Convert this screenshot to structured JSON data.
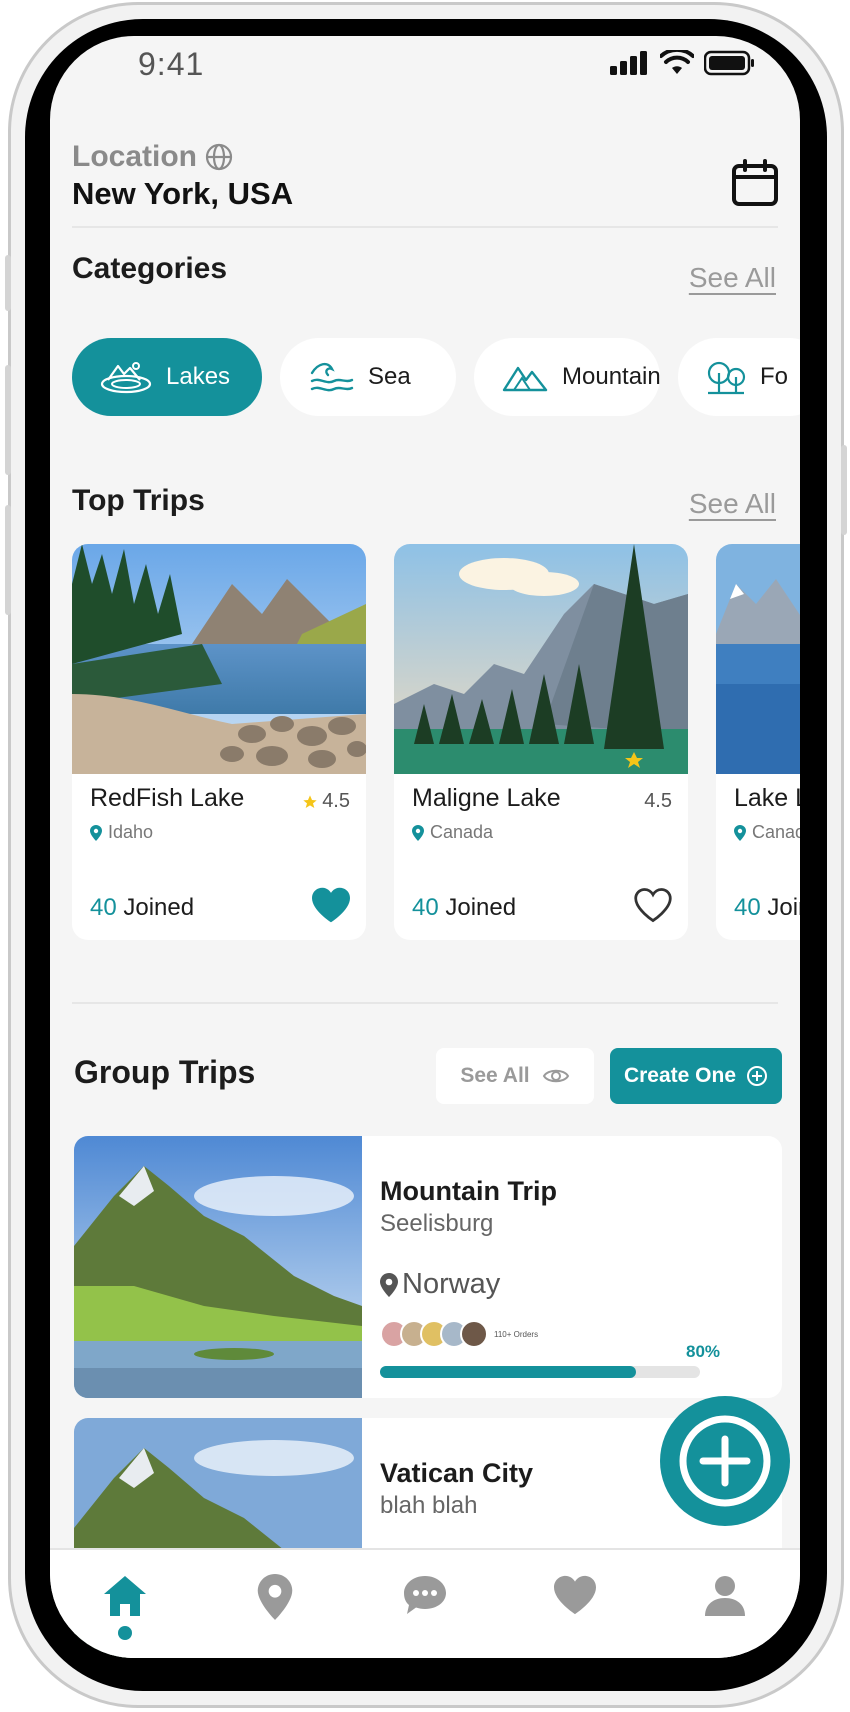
{
  "status_bar": {
    "time": "9:41"
  },
  "header": {
    "location_label": "Location",
    "location_value": "New York, USA"
  },
  "categories": {
    "title": "Categories",
    "see_all": "See All",
    "items": [
      {
        "label": "Lakes",
        "icon": "lake-icon",
        "active": true
      },
      {
        "label": "Sea",
        "icon": "wave-icon",
        "active": false
      },
      {
        "label": "Mountain",
        "icon": "mountain-icon",
        "active": false
      },
      {
        "label": "Fo",
        "icon": "forest-icon",
        "active": false
      }
    ]
  },
  "top_trips": {
    "title": "Top Trips",
    "see_all": "See All",
    "cards": [
      {
        "name": "RedFish Lake",
        "rating": "4.5",
        "place": "Idaho",
        "joined_count": "40",
        "joined_label": "Joined",
        "liked": true
      },
      {
        "name": "Maligne Lake",
        "rating": "4.5",
        "place": "Canada",
        "joined_count": "40",
        "joined_label": "Joined",
        "liked": false
      },
      {
        "name": "Lake L",
        "rating": "",
        "place": "Canada",
        "joined_count": "40",
        "joined_label": "Joined",
        "liked": false
      }
    ]
  },
  "group_trips": {
    "title": "Group Trips",
    "see_all_button": "See All",
    "create_button": "Create One",
    "cards": [
      {
        "name": "Mountain Trip",
        "subtitle": "Seelisburg",
        "country": "Norway",
        "orders": "110+ Orders",
        "progress_label": "80%",
        "progress": 0.8
      },
      {
        "name": "Vatican City",
        "subtitle": "blah blah"
      }
    ]
  },
  "bottom_nav": {
    "items": [
      {
        "icon": "home-icon",
        "active": true
      },
      {
        "icon": "location-pin-icon",
        "active": false
      },
      {
        "icon": "chat-icon",
        "active": false
      },
      {
        "icon": "heart-icon",
        "active": false
      },
      {
        "icon": "profile-icon",
        "active": false
      }
    ]
  },
  "colors": {
    "accent": "#14919b",
    "background": "#f5f5f5",
    "star": "#f5c518",
    "muted": "#9a9a9a"
  }
}
